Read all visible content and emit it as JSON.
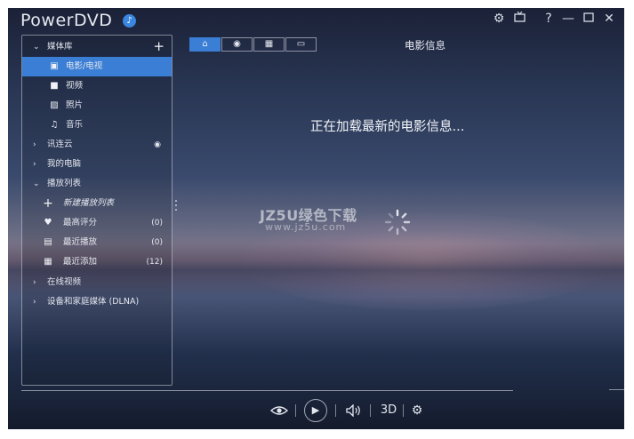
{
  "app": {
    "title": "PowerDVD"
  },
  "titlebar": {
    "icons": [
      "settings-icon",
      "tv-mode-icon",
      "help-icon",
      "minimize-icon",
      "maximize-icon",
      "close-icon"
    ]
  },
  "sidebar": {
    "media_library": "媒体库",
    "items": [
      {
        "label": "电影/电视",
        "icon": "movie-icon",
        "selected": true
      },
      {
        "label": "视频",
        "icon": "video-icon"
      },
      {
        "label": "照片",
        "icon": "photo-icon"
      },
      {
        "label": "音乐",
        "icon": "music-icon"
      }
    ],
    "cyberlink_cloud": "讯连云",
    "my_computer": "我的电脑",
    "playlists": "播放列表",
    "playlist_items": [
      {
        "label": "新建播放列表",
        "icon": "plus-icon",
        "count": ""
      },
      {
        "label": "最高评分",
        "icon": "heart-icon",
        "count": "(0)"
      },
      {
        "label": "最近播放",
        "icon": "recent-icon",
        "count": "(0)"
      },
      {
        "label": "最近添加",
        "icon": "added-icon",
        "count": "(12)"
      }
    ],
    "online_video": "在线视频",
    "dlna": "设备和家庭媒体 (DLNA)"
  },
  "panel": {
    "title": "电影信息",
    "loading_text": "正在加载最新的电影信息..."
  },
  "watermark": {
    "line1": "JZ5U绿色下载",
    "line2": "www.jz5u.com"
  },
  "controls": {
    "three_d_label": "3D"
  },
  "colors": {
    "accent": "#3a7fd5"
  }
}
